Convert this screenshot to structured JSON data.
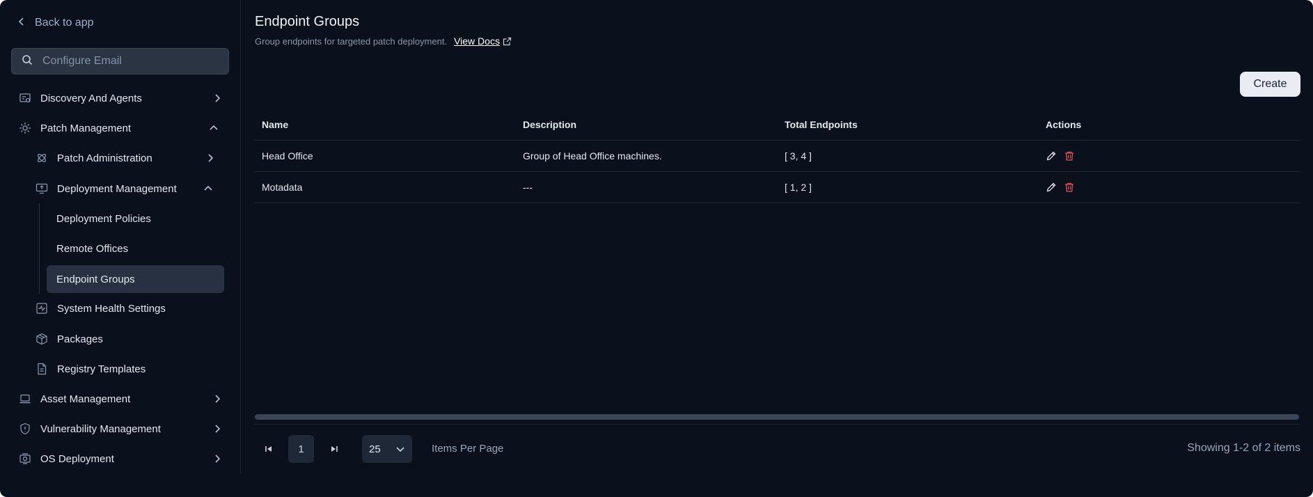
{
  "sidebar": {
    "back_label": "Back to app",
    "search_placeholder": "Configure Email",
    "items": {
      "discovery": "Discovery And Agents",
      "patch_management": "Patch Management",
      "patch_administration": "Patch Administration",
      "deployment_management": "Deployment Management",
      "deployment_policies": "Deployment Policies",
      "remote_offices": "Remote Offices",
      "endpoint_groups": "Endpoint Groups",
      "system_health": "System Health Settings",
      "packages": "Packages",
      "registry_templates": "Registry Templates",
      "asset_management": "Asset Management",
      "vulnerability_management": "Vulnerability Management",
      "os_deployment": "OS Deployment"
    },
    "active_item": "Endpoint Groups"
  },
  "page": {
    "title": "Endpoint Groups",
    "subtitle": "Group endpoints for targeted patch deployment.",
    "docs_label": "View Docs",
    "create_label": "Create"
  },
  "table": {
    "headers": [
      "Name",
      "Description",
      "Total Endpoints",
      "Actions"
    ],
    "rows": [
      {
        "name": "Head Office",
        "description": "Group of Head Office machines.",
        "endpoints": "[ 3, 4 ]"
      },
      {
        "name": "Motadata",
        "description": "---",
        "endpoints": "[ 1, 2 ]"
      }
    ]
  },
  "pagination": {
    "current_page": "1",
    "per_page": "25",
    "per_page_label": "Items Per Page",
    "showing": "Showing 1-2 of 2 items"
  },
  "colors": {
    "background": "#0a111c",
    "delete_icon": "#e05252",
    "active_bg": "#273141"
  }
}
